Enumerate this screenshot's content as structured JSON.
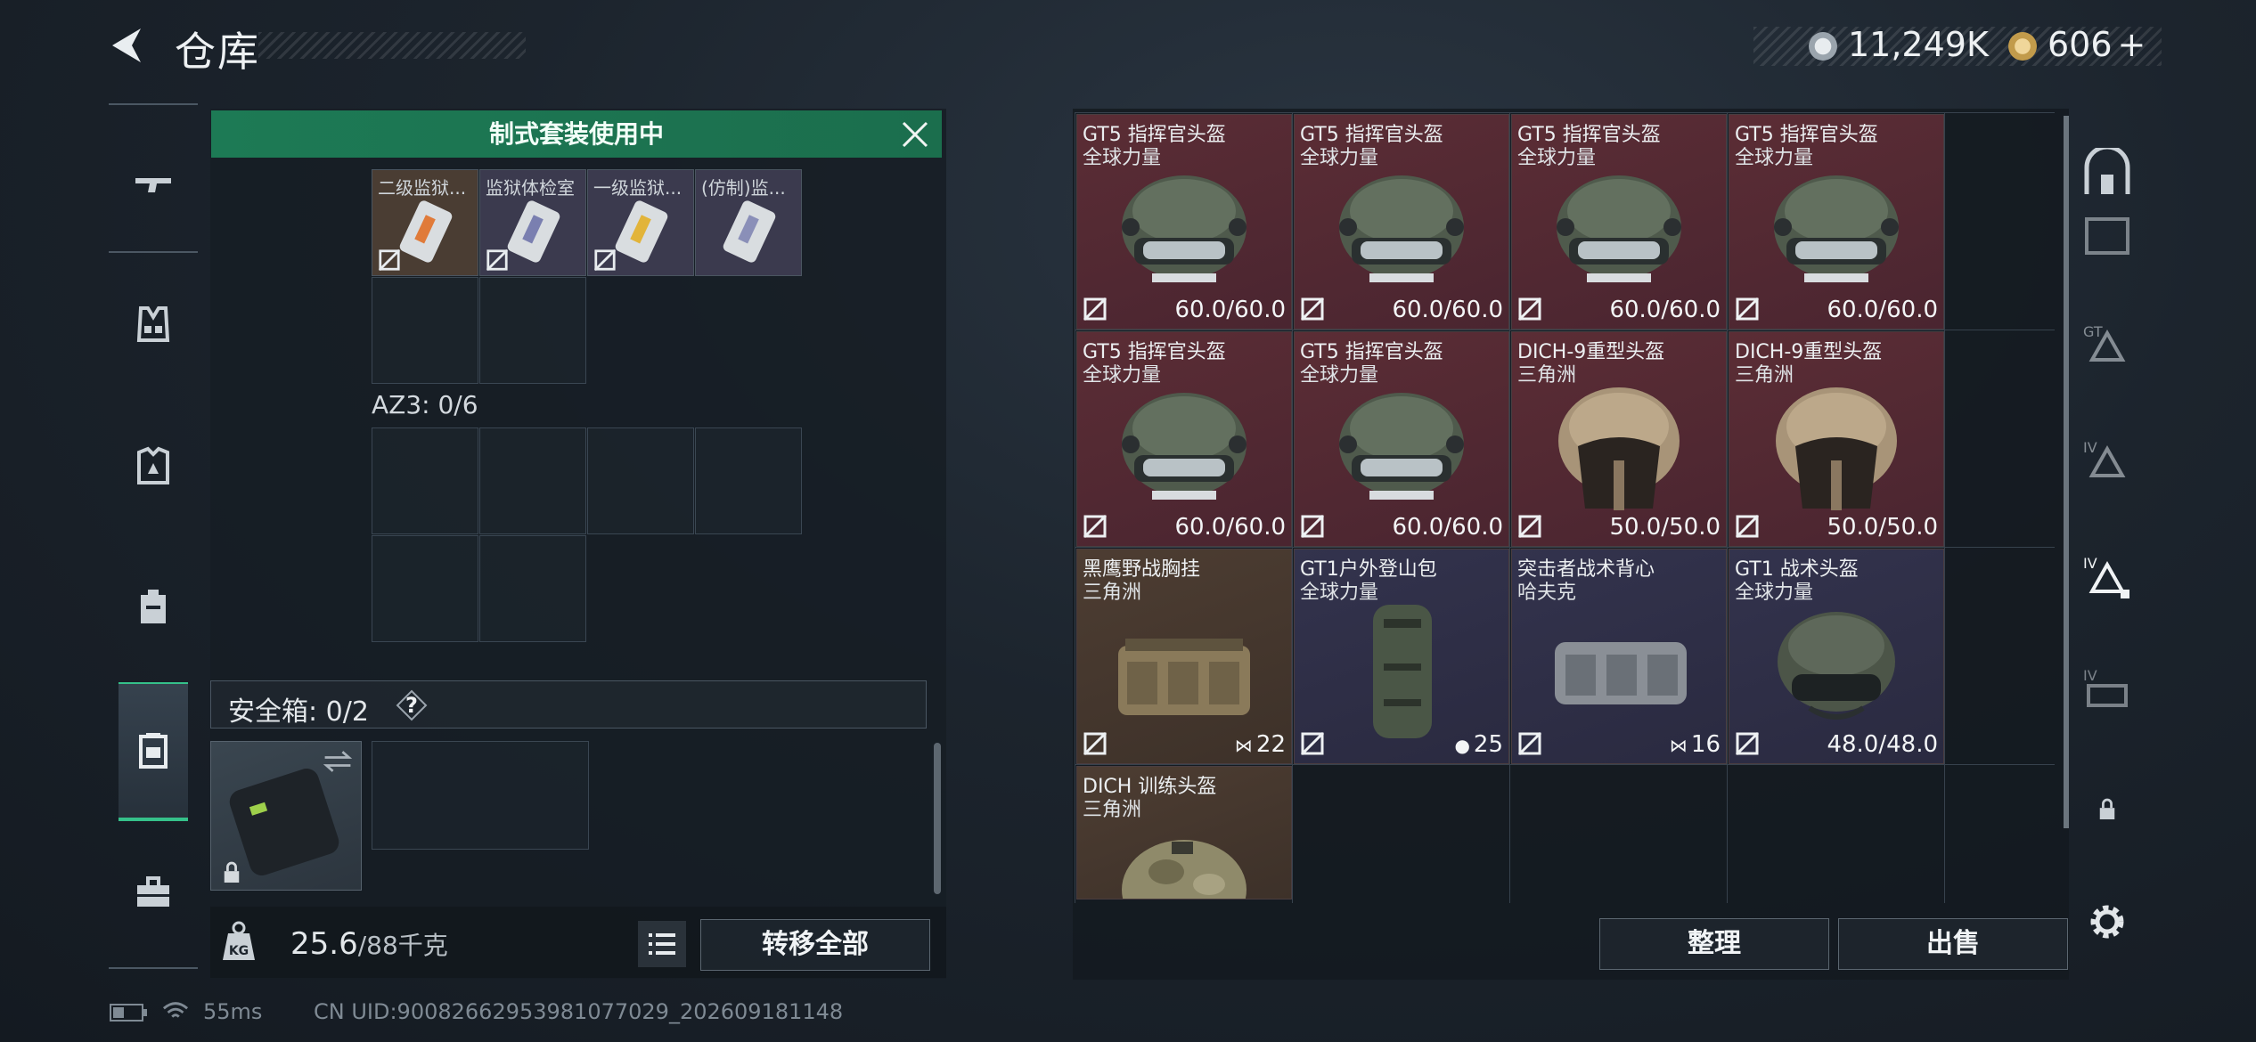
{
  "header": {
    "title": "仓库",
    "currency_1": "11,249K",
    "currency_2": "606",
    "currency_2_suffix": "+"
  },
  "left_nav": {
    "items": [
      {
        "icon": "rifle-icon",
        "active": false
      },
      {
        "icon": "vest-icon",
        "active": false
      },
      {
        "icon": "armor-icon",
        "active": false
      },
      {
        "icon": "backpack-icon",
        "active": false
      },
      {
        "icon": "container-icon",
        "active": true
      },
      {
        "icon": "toolbox-icon",
        "active": false
      }
    ]
  },
  "loadout": {
    "banner": "制式套装使用中",
    "small_items": [
      {
        "label": "二级监狱..."
      },
      {
        "label": "监狱体检室"
      },
      {
        "label": "一级监狱..."
      },
      {
        "label": "(仿制)监..."
      }
    ],
    "az3_label": "AZ3: 0/6",
    "safe_box_label": "安全箱: 0/2",
    "safe_box_help": "?",
    "weight_value": "25.6",
    "weight_unit": "/88千克",
    "transfer_all": "转移全部"
  },
  "inventory": {
    "items": [
      {
        "name": "GT5 指挥官头盔",
        "brand": "全球力量",
        "durability": "60.0/60.0",
        "rarity": "red",
        "kind": "helmet-gt5"
      },
      {
        "name": "GT5 指挥官头盔",
        "brand": "全球力量",
        "durability": "60.0/60.0",
        "rarity": "red",
        "kind": "helmet-gt5"
      },
      {
        "name": "GT5 指挥官头盔",
        "brand": "全球力量",
        "durability": "60.0/60.0",
        "rarity": "red",
        "kind": "helmet-gt5"
      },
      {
        "name": "GT5 指挥官头盔",
        "brand": "全球力量",
        "durability": "60.0/60.0",
        "rarity": "red",
        "kind": "helmet-gt5"
      },
      {
        "name": "GT5 指挥官头盔",
        "brand": "全球力量",
        "durability": "60.0/60.0",
        "rarity": "red",
        "kind": "helmet-gt5"
      },
      {
        "name": "GT5 指挥官头盔",
        "brand": "全球力量",
        "durability": "60.0/60.0",
        "rarity": "red",
        "kind": "helmet-gt5"
      },
      {
        "name": "DICH-9重型头盔",
        "brand": "三角洲",
        "durability": "50.0/50.0",
        "rarity": "red",
        "kind": "helmet-dich9"
      },
      {
        "name": "DICH-9重型头盔",
        "brand": "三角洲",
        "durability": "50.0/50.0",
        "rarity": "red",
        "kind": "helmet-dich9"
      },
      {
        "name": "黑鹰野战胸挂",
        "brand": "三角洲",
        "durability": "22",
        "rarity": "brown",
        "kind": "chest-rig"
      },
      {
        "name": "GT1户外登山包",
        "brand": "全球力量",
        "durability": "25",
        "rarity": "purple",
        "kind": "backpack"
      },
      {
        "name": "突击者战术背心",
        "brand": "哈夫克",
        "durability": "16",
        "rarity": "purple",
        "kind": "tactical-vest"
      },
      {
        "name": "GT1 战术头盔",
        "brand": "全球力量",
        "durability": "48.0/48.0",
        "rarity": "purple",
        "kind": "helmet-gt1"
      },
      {
        "name": "DICH 训练头盔",
        "brand": "三角洲",
        "durability": "",
        "rarity": "brown",
        "kind": "helmet-dich"
      }
    ],
    "sort_button": "整理",
    "sell_button": "出售"
  },
  "status_bar": {
    "ping": "55ms",
    "uid": "CN UID:9008266295398107702​9_202609181148"
  },
  "colors": {
    "accent_green": "#35c18a",
    "rarity_red": "#5b2d35",
    "rarity_brown": "#4d3d32",
    "rarity_purple": "#33334d"
  }
}
